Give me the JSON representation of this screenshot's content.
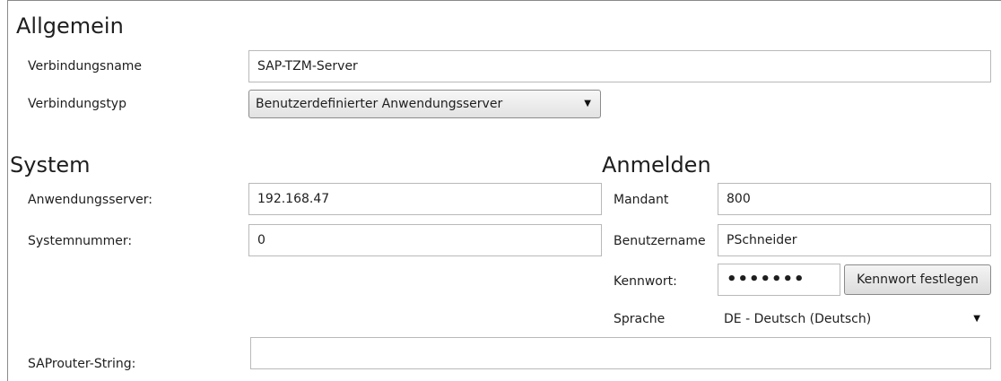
{
  "general": {
    "title": "Allgemein",
    "connection_name_label": "Verbindungsname",
    "connection_name_value": "SAP-TZM-Server",
    "connection_type_label": "Verbindungstyp",
    "connection_type_value": "Benutzerdefinierter Anwendungsserver",
    "connection_type_arrow": "▼"
  },
  "system": {
    "title": "System",
    "app_server_label": "Anwendungsserver:",
    "app_server_value": "192.168.47",
    "system_number_label": "Systemnummer:",
    "system_number_value": "0",
    "saprouter_label": "SAProuter-String:",
    "saprouter_value": ""
  },
  "login": {
    "title": "Anmelden",
    "client_label": "Mandant",
    "client_value": "800",
    "username_label": "Benutzername",
    "username_value": "PSchneider",
    "password_label": "Kennwort:",
    "password_value": "•••••••",
    "set_password_button": "Kennwort festlegen",
    "language_label": "Sprache",
    "language_value": "DE - Deutsch (Deutsch)",
    "language_arrow": "▼"
  }
}
